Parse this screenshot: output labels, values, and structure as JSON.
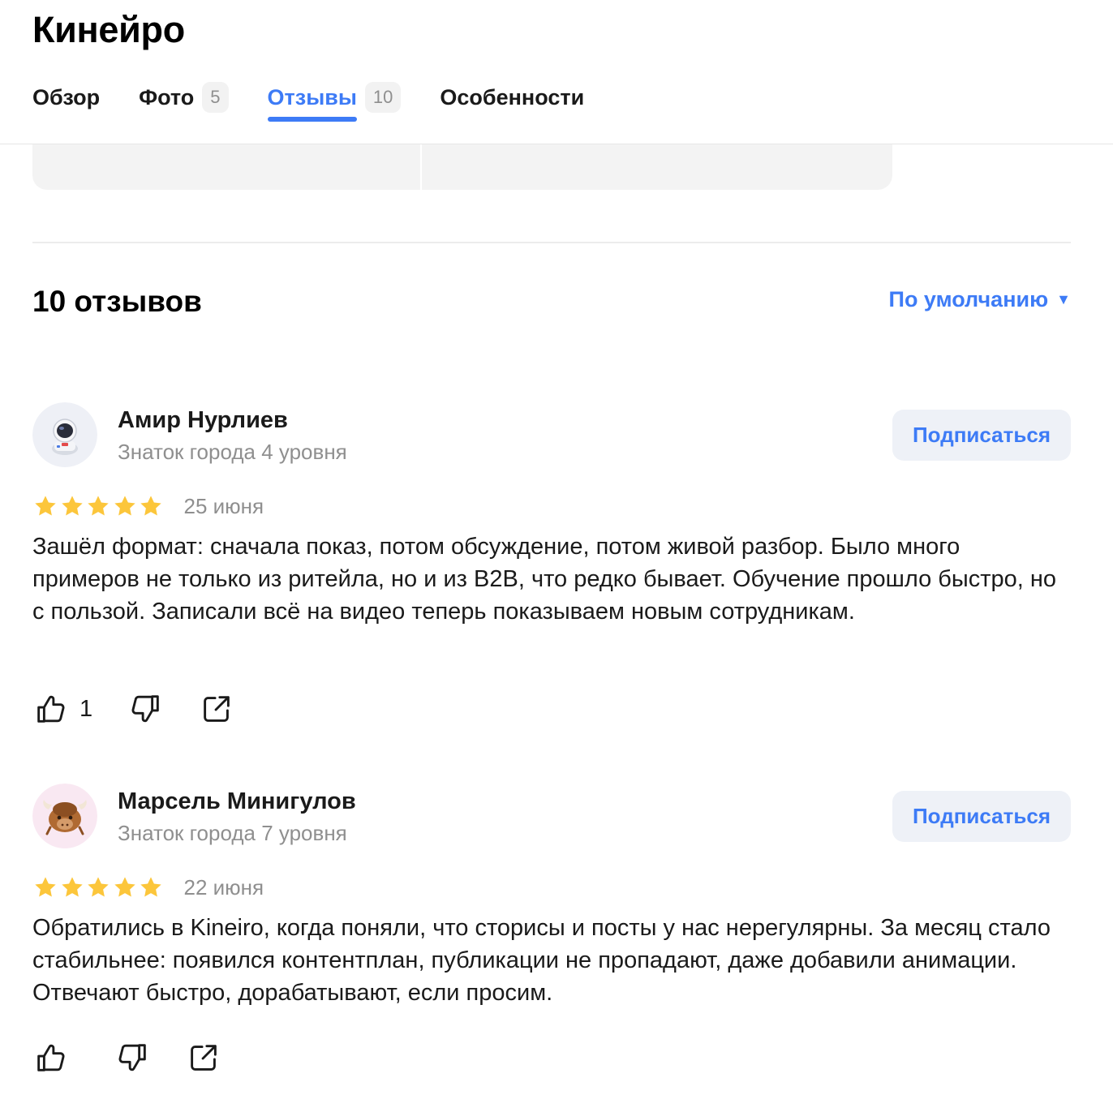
{
  "org": {
    "title": "Кинейро"
  },
  "tabs": [
    {
      "label": "Обзор",
      "count": ""
    },
    {
      "label": "Фото",
      "count": "5"
    },
    {
      "label": "Отзывы",
      "count": "10"
    },
    {
      "label": "Особенности",
      "count": ""
    }
  ],
  "active_tab": "Отзывы",
  "reviews_section": {
    "heading": "10 отзывов",
    "sort_label": "По умолчанию",
    "sort_caret": "▼"
  },
  "reviews": [
    {
      "author": "Амир Нурлиев",
      "level": "Знаток города 4 уровня",
      "subscribe_label": "Подписаться",
      "rating": 5,
      "date": "25 июня",
      "text": "Зашёл формат: сначала показ, потом обсуждение, потом живой разбор. Было много примеров не только из ритейла, но и из B2B, что редко бывает. Обучение прошло быстро, но с пользой. Записали всё на видео теперь показываем новым сотрудникам.",
      "likes": "1",
      "avatar_icon": "astronaut-icon"
    },
    {
      "author": "Марсель Минигулов",
      "level": "Знаток города 7 уровня",
      "subscribe_label": "Подписаться",
      "rating": 5,
      "date": "22 июня",
      "text": "Обратились в Kineiro, когда поняли, что сторисы и посты у нас нерегулярны. За месяц стало стабильнее: появился контентплан, публикации не пропадают, даже добавили анимации. Отвечают быстро, дорабатывают, если просим.",
      "likes": "",
      "avatar_icon": "yak-icon"
    }
  ],
  "colors": {
    "accent": "#3d7bf6",
    "star": "#fcc63b",
    "muted_text": "#8f8f8f",
    "chip_bg": "#f2f2f2",
    "button_bg": "#eef1f7"
  }
}
